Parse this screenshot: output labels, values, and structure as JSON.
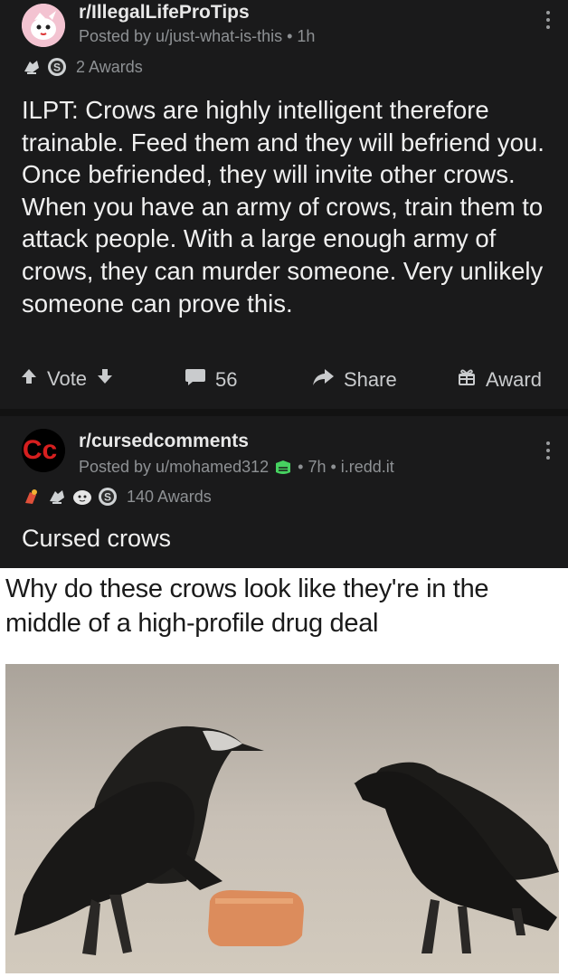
{
  "post1": {
    "subreddit": "r/IllegalLifeProTips",
    "meta": "Posted by u/just-what-is-this • 1h",
    "awards_label": "2 Awards",
    "body": "ILPT: Crows are highly intelligent therefore trainable. Feed them and they will befriend you. Once befriended, they will invite other crows. When you have an army of crows, train them to attack people. With a large enough army of crows, they can murder someone. Very unlikely someone can prove this.",
    "actions": {
      "vote": "Vote",
      "comments": "56",
      "share": "Share",
      "award": "Award"
    }
  },
  "post2": {
    "subreddit": "r/cursedcomments",
    "meta_user": "Posted by u/mohamed312",
    "meta_rest": "• 7h • i.redd.it",
    "awards_label": "140 Awards",
    "title": "Cursed crows",
    "avatar_text": "Cc",
    "image_caption": "Why do these crows look like they're in the middle of a high-profile drug deal"
  },
  "colors": {
    "background": "#121212",
    "card": "#1a1a1b",
    "mod_badge": "#46d160",
    "cursed_logo_red": "#d61f1f"
  },
  "icons": [
    "upvote-icon",
    "downvote-icon",
    "comment-icon",
    "share-icon",
    "gift-icon",
    "kebab-icon",
    "silver-award-icon",
    "helpful-award-icon",
    "wholesome-award-icon",
    "moderator-shield-icon"
  ]
}
